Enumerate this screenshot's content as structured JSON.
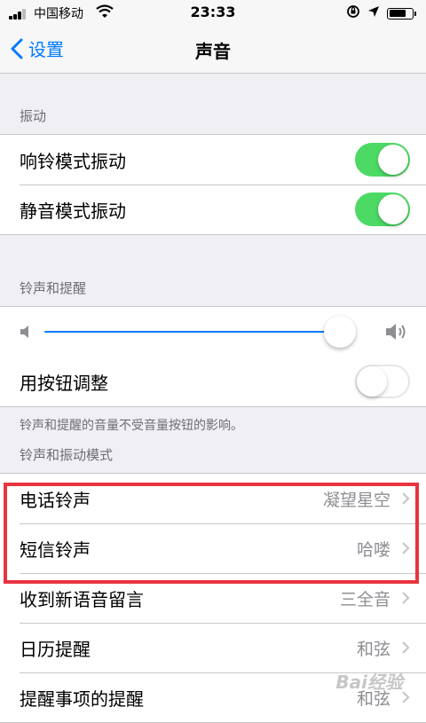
{
  "status_bar": {
    "carrier": "中国移动",
    "time": "23:33",
    "battery_level": 0.75
  },
  "nav": {
    "back_label": "设置",
    "title": "声音"
  },
  "sections": {
    "vibrate": {
      "header": "振动",
      "ring_vibrate": {
        "label": "响铃模式振动",
        "on": true
      },
      "silent_vibrate": {
        "label": "静音模式振动",
        "on": true
      }
    },
    "ringer": {
      "header": "铃声和提醒",
      "volume_level": 0.95,
      "buttons_adjust": {
        "label": "用按钮调整",
        "on": false
      },
      "footer": "铃声和提醒的音量不受音量按钮的影响。"
    },
    "patterns": {
      "header": "铃声和振动模式",
      "items": [
        {
          "label": "电话铃声",
          "value": "凝望星空"
        },
        {
          "label": "短信铃声",
          "value": "哈喽"
        },
        {
          "label": "收到新语音留言",
          "value": "三全音"
        },
        {
          "label": "日历提醒",
          "value": "和弦"
        },
        {
          "label": "提醒事项的提醒",
          "value": "和弦"
        }
      ]
    }
  },
  "colors": {
    "accent": "#007aff",
    "toggle_on": "#4cd964",
    "highlight_box": "#e8343f"
  },
  "watermark": "Bai经验"
}
